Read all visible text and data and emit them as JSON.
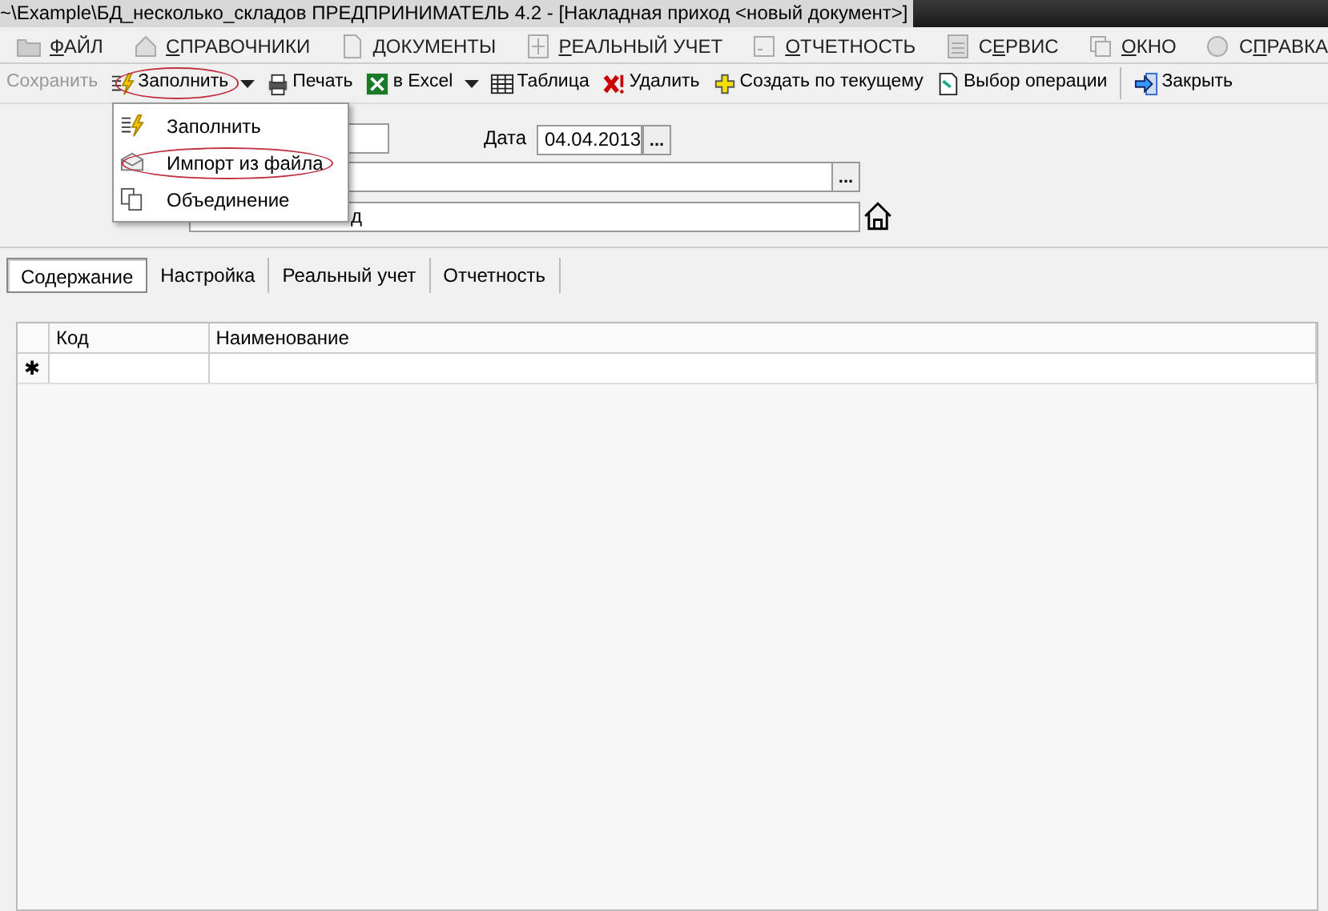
{
  "window": {
    "title": "~\\Example\\БД_несколько_складов  ПРЕДПРИНИМАТЕЛЬ 4.2 - [Накладная приход <новый документ>]"
  },
  "menu": [
    {
      "accel": "Ф",
      "after": "АЙЛ"
    },
    {
      "accel": "С",
      "after": "ПРАВОЧНИКИ"
    },
    {
      "accel": "Д",
      "after": "ОКУМЕНТЫ"
    },
    {
      "accel": "Р",
      "after": "ЕАЛЬНЫЙ УЧЕТ"
    },
    {
      "accel": "О",
      "after": "ТЧЕТНОСТЬ"
    },
    {
      "before": "С",
      "accel": "Е",
      "after": "РВИС"
    },
    {
      "accel": "О",
      "after": "КНО"
    },
    {
      "before": "С",
      "accel": "П",
      "after": "РАВКА"
    }
  ],
  "toolbar": [
    {
      "kind": "button",
      "label": "Сохранить",
      "disabled": true
    },
    {
      "kind": "button",
      "label": "Заполнить",
      "disabled": false,
      "circled": true
    },
    {
      "kind": "arrow"
    },
    {
      "kind": "button",
      "label": "Печать",
      "disabled": false
    },
    {
      "kind": "button",
      "label": "в Excel",
      "disabled": false
    },
    {
      "kind": "arrow"
    },
    {
      "kind": "button",
      "label": "Таблица",
      "disabled": false
    },
    {
      "kind": "button",
      "label": "Удалить",
      "disabled": false
    },
    {
      "kind": "button",
      "label": "Создать по текущему",
      "disabled": false
    },
    {
      "kind": "button",
      "label": "Выбор операции",
      "disabled": false
    },
    {
      "kind": "separator"
    },
    {
      "kind": "button",
      "label": "Закрыть",
      "disabled": false
    }
  ],
  "fill_menu": [
    {
      "label": "Заполнить",
      "circled": false
    },
    {
      "label": "Импорт из файла",
      "circled": true
    },
    {
      "label": "Объединение",
      "circled": false
    }
  ],
  "form": {
    "date_label": "Дата",
    "date_value": "04.04.2013",
    "date_button": "...",
    "field_2_button": "...",
    "field_3_value": "д"
  },
  "tabs": [
    {
      "label": "Содержание",
      "selected": true
    },
    {
      "label": "Настройка",
      "selected": false
    },
    {
      "label": "Реальный учет",
      "selected": false
    },
    {
      "label": "Отчетность",
      "selected": false
    }
  ],
  "grid": {
    "columns": [
      "Код",
      "Наименование"
    ],
    "new_row_marker": "✱"
  }
}
